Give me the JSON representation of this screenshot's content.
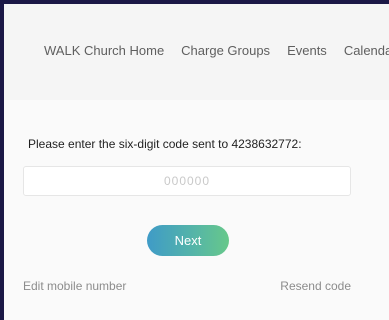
{
  "nav": {
    "items": [
      "WALK Church Home",
      "Charge Groups",
      "Events",
      "Calendar"
    ]
  },
  "verify": {
    "prompt_text": "Please enter the six-digit code sent to 4238632772:",
    "code_value": "",
    "code_placeholder": "000000",
    "next_label": "Next",
    "edit_label": "Edit mobile number",
    "resend_label": "Resend code"
  },
  "colors": {
    "frame_background": "#1b1846",
    "page_background": "#f9f9f9",
    "button_gradient_start": "#3f9bc7",
    "button_gradient_end": "#67c88a"
  }
}
